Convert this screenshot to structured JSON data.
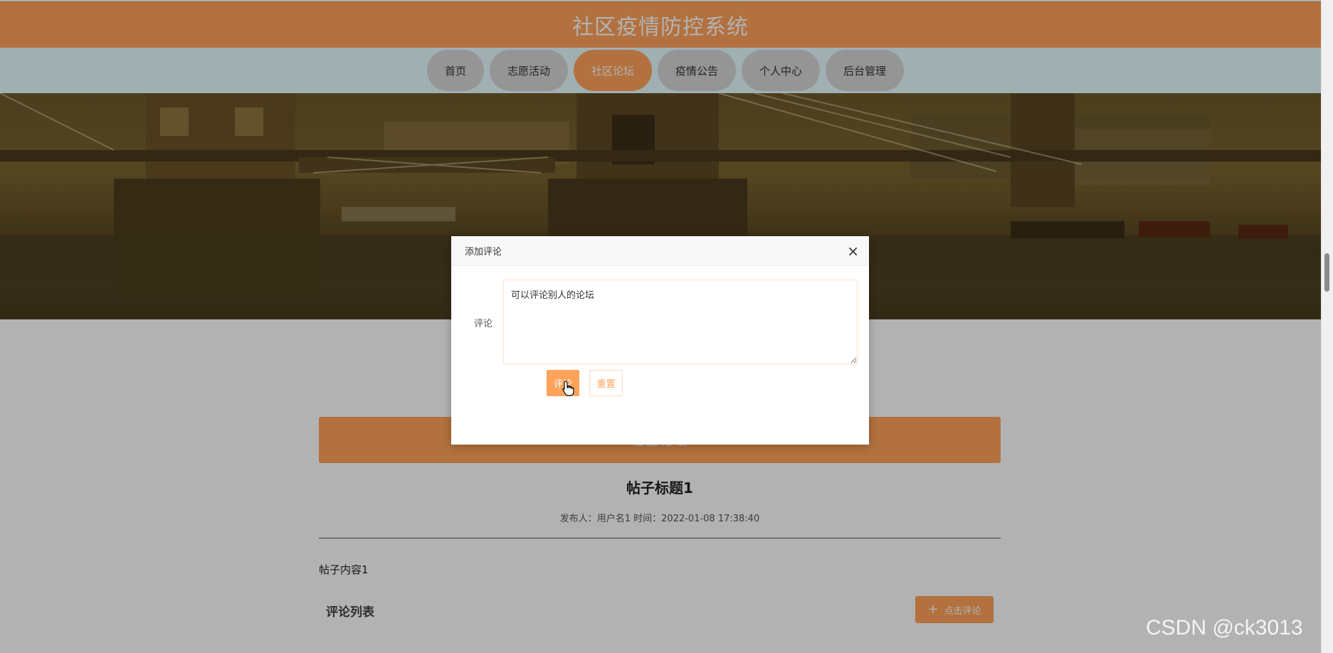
{
  "header": {
    "title": "社区疫情防控系统"
  },
  "nav": {
    "items": [
      {
        "label": "首页",
        "active": false
      },
      {
        "label": "志愿活动",
        "active": false
      },
      {
        "label": "社区论坛",
        "active": true
      },
      {
        "label": "疫情公告",
        "active": false
      },
      {
        "label": "个人中心",
        "active": false
      },
      {
        "label": "后台管理",
        "active": false
      }
    ]
  },
  "section": {
    "title": "社区论坛"
  },
  "post": {
    "title": "帖子标题1",
    "meta": "发布人：用户名1 时间：2022-01-08 17:38:40",
    "content": "帖子内容1"
  },
  "comments": {
    "heading": "评论列表",
    "add_button_label": "点击评论"
  },
  "modal": {
    "title": "添加评论",
    "close_symbol": "×",
    "field_label": "评论",
    "field_value": "可以评论别人的论坛",
    "submit_label": "评论",
    "reset_label": "重置"
  },
  "watermark": "CSDN @ck3013",
  "colors": {
    "accent": "#ffa35a",
    "nav_bg": "#e6fcff",
    "nav_inactive": "#d6d6d6"
  }
}
